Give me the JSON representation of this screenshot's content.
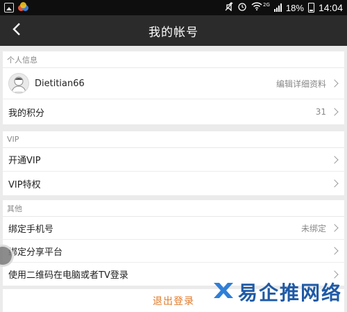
{
  "status_bar": {
    "network_badge": "2G",
    "battery_percent": "18%",
    "time": "14:04"
  },
  "header": {
    "title": "我的帐号"
  },
  "sections": {
    "personal": {
      "label": "个人信息",
      "profile": {
        "username": "Dietitian66",
        "action": "编辑详细资料"
      },
      "points": {
        "label": "我的积分",
        "value": "31"
      }
    },
    "vip": {
      "label": "VIP",
      "items": [
        {
          "label": "开通VIP"
        },
        {
          "label": "VIP特权"
        }
      ]
    },
    "other": {
      "label": "其他",
      "items": [
        {
          "label": "绑定手机号",
          "value": "未绑定"
        },
        {
          "label": "绑定分享平台",
          "value": ""
        },
        {
          "label": "使用二维码在电脑或者TV登录",
          "value": ""
        }
      ]
    }
  },
  "logout": {
    "label": "退出登录"
  },
  "watermark": {
    "text": "易企推网络"
  },
  "colors": {
    "accent": "#e07a2a",
    "header_bg": "#2b2b2b",
    "watermark": "#1f5aa6"
  }
}
